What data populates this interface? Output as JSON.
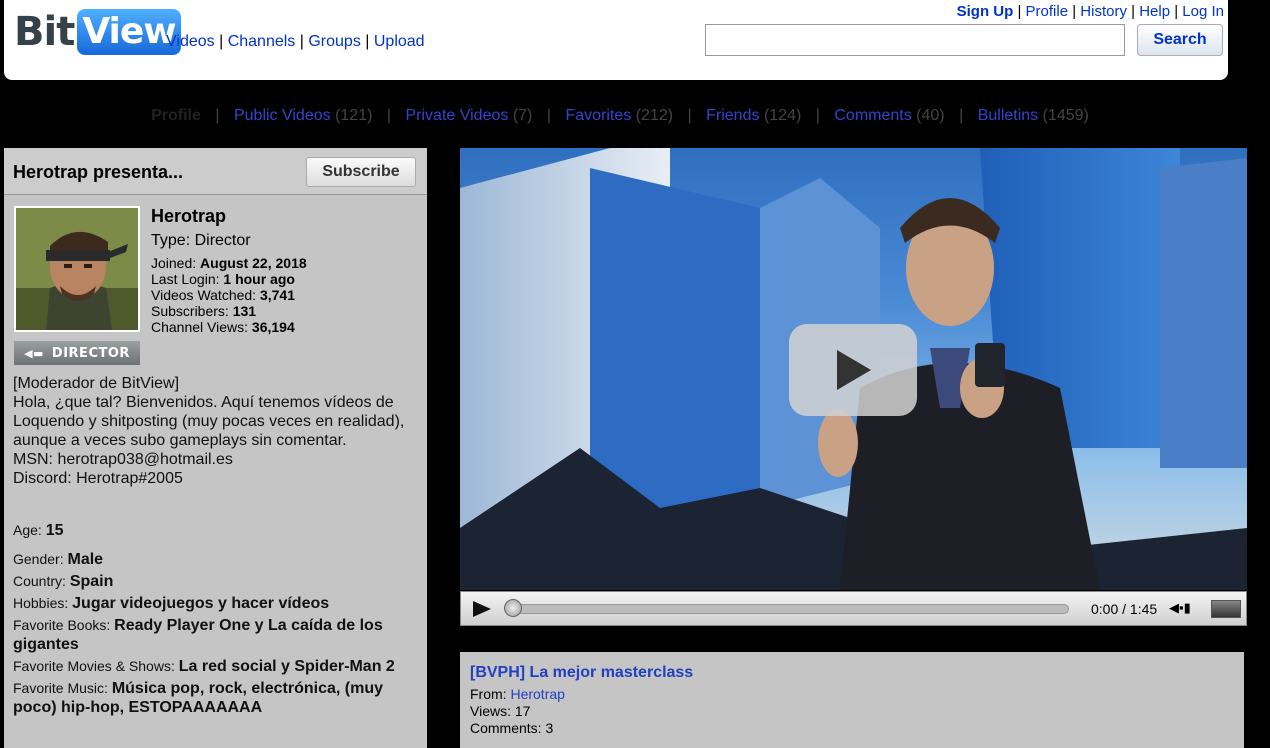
{
  "header": {
    "logo_bit": "Bit",
    "logo_view": "View",
    "nav": [
      "Videos",
      "Channels",
      "Groups",
      "Upload"
    ],
    "user_links": [
      "Sign Up",
      "Profile",
      "History",
      "Help",
      "Log In"
    ],
    "search_button": "Search",
    "search_value": ""
  },
  "tabs": [
    {
      "label": "Profile",
      "count": ""
    },
    {
      "label": "Public Videos",
      "count": "(121)"
    },
    {
      "label": "Private Videos",
      "count": "(7)"
    },
    {
      "label": "Favorites",
      "count": "(212)"
    },
    {
      "label": "Friends",
      "count": "(124)"
    },
    {
      "label": "Comments",
      "count": "(40)"
    },
    {
      "label": "Bulletins",
      "count": "(1459)"
    }
  ],
  "profile": {
    "heading": "Herotrap presenta...",
    "subscribe": "Subscribe",
    "name": "Herotrap",
    "type": "Type: Director",
    "badge": "DIRECTOR",
    "stats": [
      {
        "label": "Joined:",
        "value": "August 22, 2018"
      },
      {
        "label": "Last Login:",
        "value": "1 hour ago"
      },
      {
        "label": "Videos Watched:",
        "value": "3,741"
      },
      {
        "label": "Subscribers:",
        "value": "131"
      },
      {
        "label": "Channel Views:",
        "value": "36,194"
      }
    ],
    "bio": [
      "[Moderador de BitView]",
      "Hola, ¿que tal? Bienvenidos. Aquí tenemos vídeos de Loquendo y shitposting (muy pocas veces en realidad), aunque a veces subo gameplays sin comentar.",
      "MSN: herotrap038@hotmail.es",
      "Discord: Herotrap#2005"
    ],
    "fields": [
      {
        "label": "Age:",
        "value": "15"
      },
      {
        "label": "Gender:",
        "value": "Male"
      },
      {
        "label": "Country:",
        "value": "Spain"
      },
      {
        "label": "Hobbies:",
        "value": "Jugar videojuegos y hacer vídeos"
      },
      {
        "label": "Favorite Books:",
        "value": "Ready Player One y La caída de los gigantes"
      },
      {
        "label": "Favorite Movies & Shows:",
        "value": "La red social y Spider-Man 2"
      },
      {
        "label": "Favorite Music:",
        "value": "Música pop, rock, electrónica, (muy poco) hip-hop, ESTOPAAAAAAA"
      }
    ]
  },
  "player": {
    "time": "0:00 / 1:45",
    "progress": 0
  },
  "video": {
    "title": "[BVPH] La mejor masterclass",
    "from_label": "From:",
    "from": "Herotrap",
    "views": "Views: 17",
    "comments": "Comments: 3"
  },
  "colors": {
    "background": "#000000",
    "panel": "#c5c5c5",
    "link": "#0033cc"
  }
}
